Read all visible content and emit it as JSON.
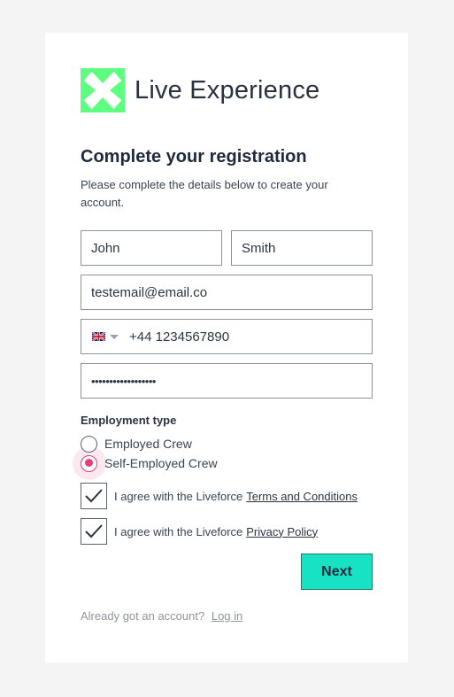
{
  "brand": {
    "name": "Live Experience",
    "logo_color": "#5cff7f"
  },
  "form": {
    "title": "Complete your registration",
    "subtitle": "Please complete the details below to create your account.",
    "first_name": "John",
    "last_name": "Smith",
    "email": "testemail@email.co",
    "phone_country_icon": "uk-flag-icon",
    "phone": "+44 1234567890",
    "password_masked": "••••••••••••••••••",
    "employment": {
      "label": "Employment type",
      "options": [
        {
          "label": "Employed Crew",
          "selected": false
        },
        {
          "label": "Self-Employed Crew",
          "selected": true
        }
      ]
    },
    "agreements": [
      {
        "text": "I agree with the Liveforce",
        "link": "Terms and Conditions",
        "checked": true
      },
      {
        "text": "I agree with the Liveforce",
        "link": "Privacy Policy",
        "checked": true
      }
    ],
    "next_label": "Next"
  },
  "footer": {
    "text": "Already got an account?",
    "login_link": "Log in"
  },
  "colors": {
    "accent_button": "#17e2c4",
    "radio_selected": "#e53e78"
  }
}
